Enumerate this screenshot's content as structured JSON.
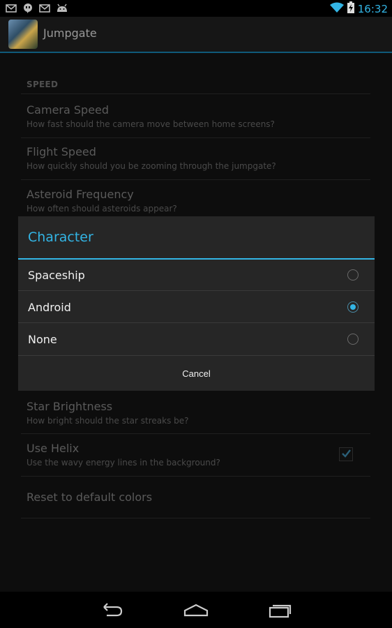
{
  "status_bar": {
    "time": "16:32",
    "notification_icons": [
      "gmail-icon",
      "hangouts-icon",
      "gmail-icon",
      "android-debug-icon"
    ],
    "system_icons": [
      "wifi-icon",
      "battery-charging-icon"
    ]
  },
  "action_bar": {
    "title": "Jumpgate"
  },
  "preferences": {
    "category": "SPEED",
    "items": [
      {
        "title": "Camera Speed",
        "summary": "How fast should the camera move between home screens?"
      },
      {
        "title": "Flight Speed",
        "summary": "How quickly should you be zooming through the jumpgate?"
      },
      {
        "title": "Asteroid Frequency",
        "summary": "How often should asteroids appear?"
      },
      {
        "title": "Star Brightness",
        "summary": "How bright should the star streaks be?"
      },
      {
        "title": "Use Helix",
        "summary": "Use the wavy energy lines in the background?",
        "checked": true
      },
      {
        "title": "Reset to default colors",
        "summary": ""
      }
    ]
  },
  "dialog": {
    "title": "Character",
    "options": [
      {
        "label": "Spaceship",
        "selected": false
      },
      {
        "label": "Android",
        "selected": true
      },
      {
        "label": "None",
        "selected": false
      }
    ],
    "cancel_label": "Cancel"
  },
  "nav_bar": {
    "buttons": [
      "back-icon",
      "home-icon",
      "recents-icon"
    ]
  },
  "colors": {
    "accent": "#33b5e5",
    "dialog_bg": "#262626"
  }
}
